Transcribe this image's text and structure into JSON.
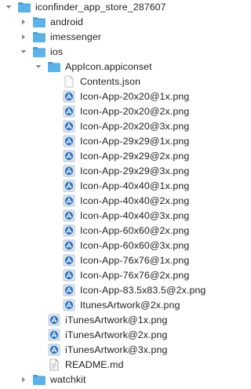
{
  "file_tree": {
    "items": [
      {
        "label": "iconfinder_app_store_287607",
        "type": "folder",
        "depth": 0,
        "expanded": true
      },
      {
        "label": "android",
        "type": "folder",
        "depth": 1,
        "expanded": false
      },
      {
        "label": "imessenger",
        "type": "folder",
        "depth": 1,
        "expanded": false
      },
      {
        "label": "ios",
        "type": "folder",
        "depth": 1,
        "expanded": true
      },
      {
        "label": "AppIcon.appiconset",
        "type": "folder",
        "depth": 2,
        "expanded": true
      },
      {
        "label": "Contents.json",
        "type": "json",
        "depth": 3
      },
      {
        "label": "Icon-App-20x20@1x.png",
        "type": "png",
        "depth": 3
      },
      {
        "label": "Icon-App-20x20@2x.png",
        "type": "png",
        "depth": 3
      },
      {
        "label": "Icon-App-20x20@3x.png",
        "type": "png",
        "depth": 3
      },
      {
        "label": "Icon-App-29x29@1x.png",
        "type": "png",
        "depth": 3
      },
      {
        "label": "Icon-App-29x29@2x.png",
        "type": "png",
        "depth": 3
      },
      {
        "label": "Icon-App-29x29@3x.png",
        "type": "png",
        "depth": 3
      },
      {
        "label": "Icon-App-40x40@1x.png",
        "type": "png",
        "depth": 3
      },
      {
        "label": "Icon-App-40x40@2x.png",
        "type": "png",
        "depth": 3
      },
      {
        "label": "Icon-App-40x40@3x.png",
        "type": "png",
        "depth": 3
      },
      {
        "label": "Icon-App-60x60@2x.png",
        "type": "png",
        "depth": 3
      },
      {
        "label": "Icon-App-60x60@3x.png",
        "type": "png",
        "depth": 3
      },
      {
        "label": "Icon-App-76x76@1x.png",
        "type": "png",
        "depth": 3
      },
      {
        "label": "Icon-App-76x76@2x.png",
        "type": "png",
        "depth": 3
      },
      {
        "label": "Icon-App-83.5x83.5@2x.png",
        "type": "png",
        "depth": 3
      },
      {
        "label": "ItunesArtwork@2x.png",
        "type": "png",
        "depth": 3
      },
      {
        "label": "iTunesArtwork@1x.png",
        "type": "png",
        "depth": 2
      },
      {
        "label": "iTunesArtwork@2x.png",
        "type": "png",
        "depth": 2
      },
      {
        "label": "iTunesArtwork@3x.png",
        "type": "png",
        "depth": 2
      },
      {
        "label": "README.md",
        "type": "md",
        "depth": 2
      },
      {
        "label": "watchkit",
        "type": "folder",
        "depth": 1,
        "expanded": false
      }
    ]
  },
  "colors": {
    "folder_body": "#5ab4ea",
    "folder_tab": "#3f9ad9",
    "chevron": "#8a8a8a",
    "text": "#1f1f1f",
    "png_icon": "#2f78c4"
  },
  "icons": {
    "folder": "folder-icon",
    "json": "json-file-icon",
    "png": "image-file-icon",
    "md": "markdown-file-icon",
    "expanded": "chevron-down-icon",
    "collapsed": "chevron-right-icon"
  }
}
